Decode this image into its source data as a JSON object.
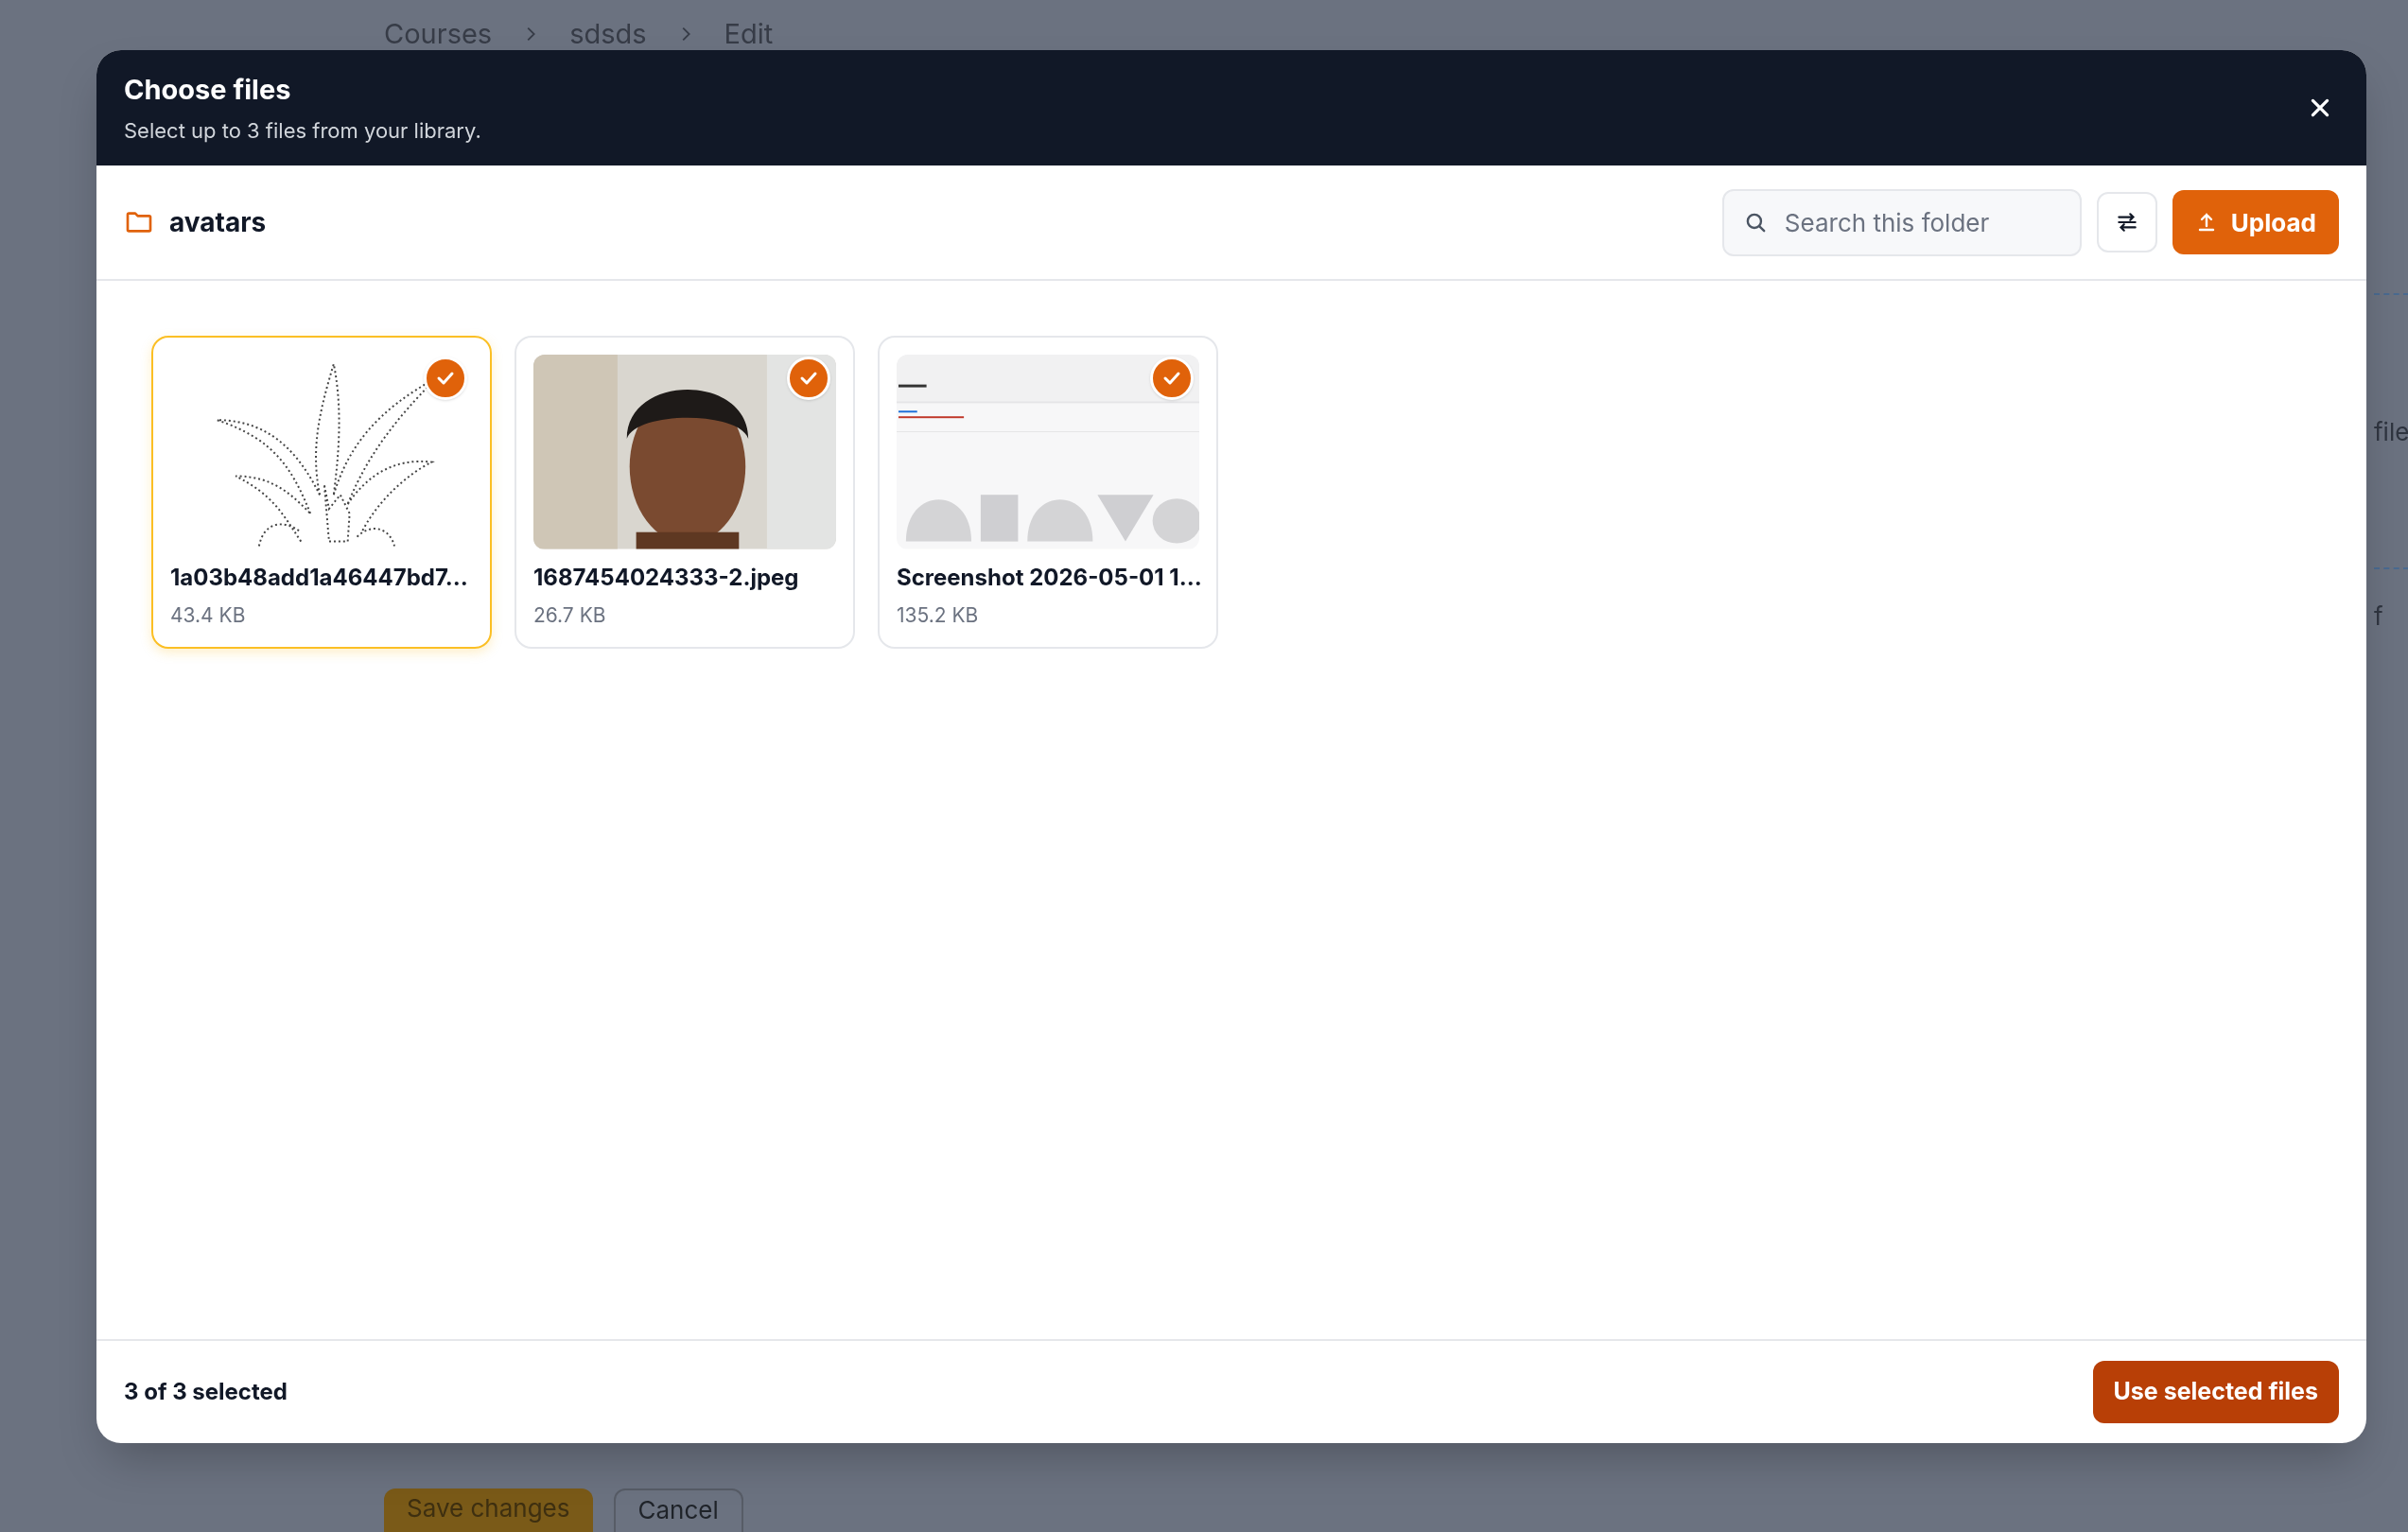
{
  "background_page": {
    "breadcrumb": [
      "Courses",
      "sdsds",
      "Edit"
    ],
    "side_texts": [
      "file",
      "f"
    ],
    "buttons": [
      {
        "label": "Save changes",
        "kind": "primary"
      },
      {
        "label": "Cancel",
        "kind": "secondary"
      }
    ]
  },
  "dialog": {
    "title": "Choose files",
    "subtitle": "Select up to 3 files from your library.",
    "folder": "avatars",
    "search": {
      "placeholder": "Search this folder"
    },
    "upload_button": "Upload",
    "files": [
      {
        "name": "1a03b48add1a46447bd7…",
        "size": "43.4 KB",
        "selected": true,
        "focused": true,
        "kind": "drawing"
      },
      {
        "name": "1687454024333-2.jpeg",
        "size": "26.7 KB",
        "selected": true,
        "focused": false
      },
      {
        "name": "Screenshot 2026-05-01 1…",
        "size": "135.2 KB",
        "selected": true,
        "focused": false,
        "kind": "screenshot"
      }
    ],
    "footer": {
      "count": "3 of 3 selected",
      "button": "Use selected files"
    }
  }
}
